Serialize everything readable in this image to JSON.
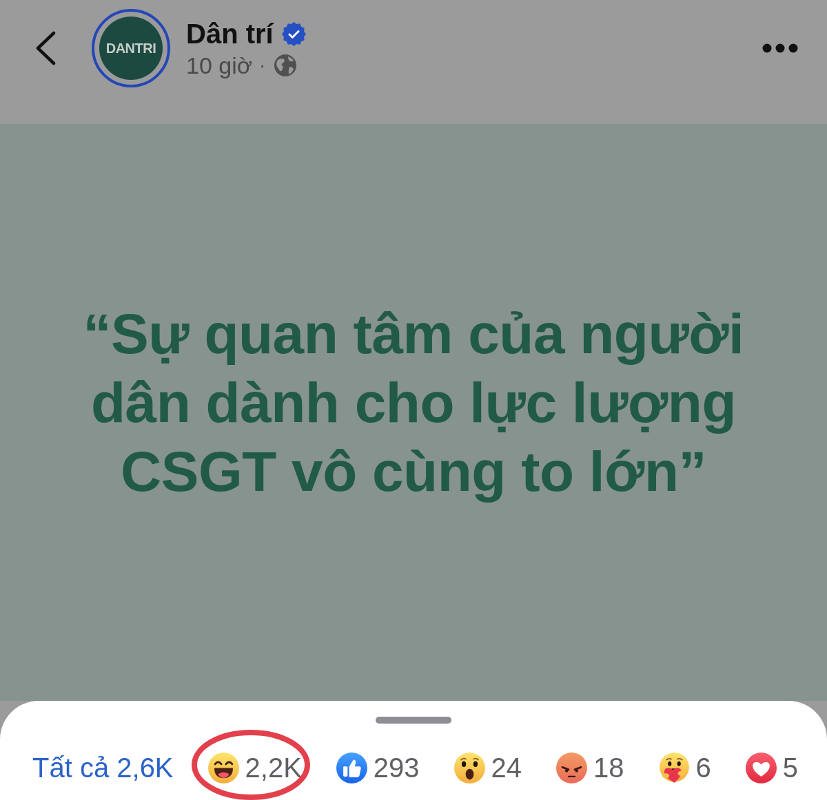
{
  "header": {
    "avatar_logo": "DANTRI",
    "name": "Dân trí",
    "verified": true,
    "time": "10 giờ",
    "separator": "·"
  },
  "post": {
    "quote": "“Sự quan tâm của người dân dành cho lực lượng CSGT vô cùng to lớn”"
  },
  "reactions": [
    {
      "kind": "all",
      "label": "Tất cả 2,6K",
      "selected": true,
      "circled": false
    },
    {
      "kind": "haha",
      "label": "2,2K",
      "selected": false,
      "circled": true
    },
    {
      "kind": "like",
      "label": "293",
      "selected": false,
      "circled": false
    },
    {
      "kind": "wow",
      "label": "24",
      "selected": false,
      "circled": false
    },
    {
      "kind": "angry",
      "label": "18",
      "selected": false,
      "circled": false
    },
    {
      "kind": "care",
      "label": "6",
      "selected": false,
      "circled": false
    },
    {
      "kind": "love",
      "label": "5",
      "selected": false,
      "circled": false
    }
  ]
}
